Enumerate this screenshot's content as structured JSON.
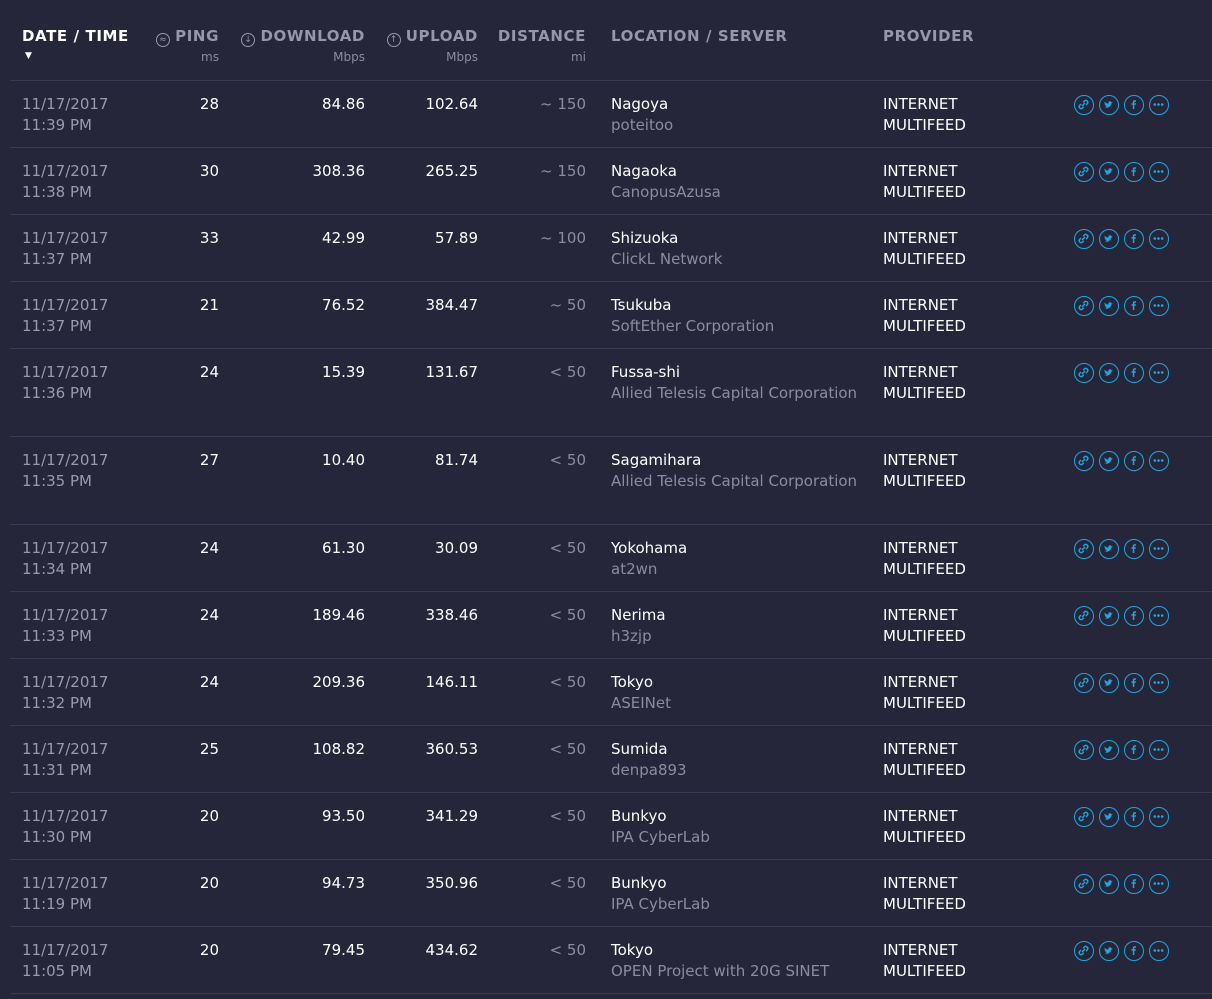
{
  "header": {
    "date_time": "DATE / TIME",
    "ping": "PING",
    "ping_unit": "ms",
    "download": "DOWNLOAD",
    "download_unit": "Mbps",
    "upload": "UPLOAD",
    "upload_unit": "Mbps",
    "distance": "DISTANCE",
    "distance_unit": "mi",
    "location": "LOCATION / SERVER",
    "provider": "PROVIDER"
  },
  "colors": {
    "background": "#26263a",
    "accent": "#1fa7e1",
    "muted": "#9797a9",
    "text": "#ffffff"
  },
  "icons": [
    "ping-icon",
    "download-icon",
    "upload-icon",
    "link-icon",
    "twitter-icon",
    "facebook-icon",
    "more-icon"
  ],
  "rows": [
    {
      "date": "11/17/2017",
      "time": "11:39 PM",
      "ping": "28",
      "download": "84.86",
      "upload": "102.64",
      "distance": "~ 150",
      "city": "Nagoya",
      "server": "poteitoo",
      "provider1": "INTERNET",
      "provider2": "MULTIFEED"
    },
    {
      "date": "11/17/2017",
      "time": "11:38 PM",
      "ping": "30",
      "download": "308.36",
      "upload": "265.25",
      "distance": "~ 150",
      "city": "Nagaoka",
      "server": "CanopusAzusa",
      "provider1": "INTERNET",
      "provider2": "MULTIFEED"
    },
    {
      "date": "11/17/2017",
      "time": "11:37 PM",
      "ping": "33",
      "download": "42.99",
      "upload": "57.89",
      "distance": "~ 100",
      "city": "Shizuoka",
      "server": "ClickL Network",
      "provider1": "INTERNET",
      "provider2": "MULTIFEED"
    },
    {
      "date": "11/17/2017",
      "time": "11:37 PM",
      "ping": "21",
      "download": "76.52",
      "upload": "384.47",
      "distance": "~ 50",
      "city": "Tsukuba",
      "server": "SoftEther Corporation",
      "provider1": "INTERNET",
      "provider2": "MULTIFEED"
    },
    {
      "date": "11/17/2017",
      "time": "11:36 PM",
      "ping": "24",
      "download": "15.39",
      "upload": "131.67",
      "distance": "< 50",
      "city": "Fussa-shi",
      "server": "Allied Telesis Capital Corporation",
      "provider1": "INTERNET",
      "provider2": "MULTIFEED"
    },
    {
      "date": "11/17/2017",
      "time": "11:35 PM",
      "ping": "27",
      "download": "10.40",
      "upload": "81.74",
      "distance": "< 50",
      "city": "Sagamihara",
      "server": "Allied Telesis Capital Corporation",
      "provider1": "INTERNET",
      "provider2": "MULTIFEED"
    },
    {
      "date": "11/17/2017",
      "time": "11:34 PM",
      "ping": "24",
      "download": "61.30",
      "upload": "30.09",
      "distance": "< 50",
      "city": "Yokohama",
      "server": "at2wn",
      "provider1": "INTERNET",
      "provider2": "MULTIFEED"
    },
    {
      "date": "11/17/2017",
      "time": "11:33 PM",
      "ping": "24",
      "download": "189.46",
      "upload": "338.46",
      "distance": "< 50",
      "city": "Nerima",
      "server": "h3zjp",
      "provider1": "INTERNET",
      "provider2": "MULTIFEED"
    },
    {
      "date": "11/17/2017",
      "time": "11:32 PM",
      "ping": "24",
      "download": "209.36",
      "upload": "146.11",
      "distance": "< 50",
      "city": "Tokyo",
      "server": "ASEINet",
      "provider1": "INTERNET",
      "provider2": "MULTIFEED"
    },
    {
      "date": "11/17/2017",
      "time": "11:31 PM",
      "ping": "25",
      "download": "108.82",
      "upload": "360.53",
      "distance": "< 50",
      "city": "Sumida",
      "server": "denpa893",
      "provider1": "INTERNET",
      "provider2": "MULTIFEED"
    },
    {
      "date": "11/17/2017",
      "time": "11:30 PM",
      "ping": "20",
      "download": "93.50",
      "upload": "341.29",
      "distance": "< 50",
      "city": "Bunkyo",
      "server": "IPA CyberLab",
      "provider1": "INTERNET",
      "provider2": "MULTIFEED"
    },
    {
      "date": "11/17/2017",
      "time": "11:19 PM",
      "ping": "20",
      "download": "94.73",
      "upload": "350.96",
      "distance": "< 50",
      "city": "Bunkyo",
      "server": "IPA CyberLab",
      "provider1": "INTERNET",
      "provider2": "MULTIFEED"
    },
    {
      "date": "11/17/2017",
      "time": "11:05 PM",
      "ping": "20",
      "download": "79.45",
      "upload": "434.62",
      "distance": "< 50",
      "city": "Tokyo",
      "server": "OPEN Project with 20G SINET",
      "provider1": "INTERNET",
      "provider2": "MULTIFEED"
    }
  ]
}
